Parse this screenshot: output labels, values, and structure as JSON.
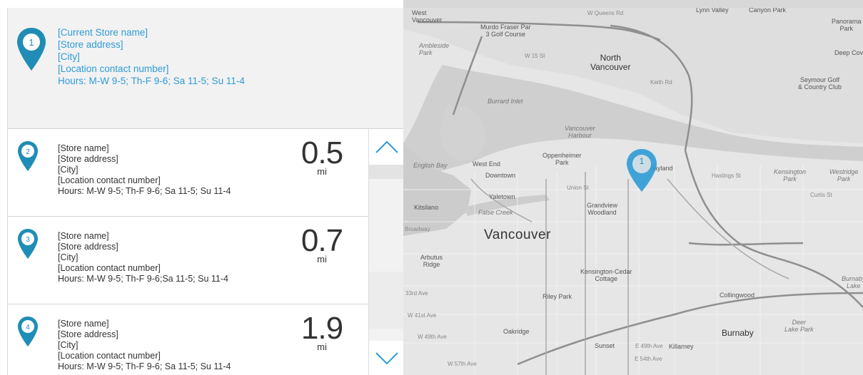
{
  "current_store": {
    "number": "1",
    "name": "[Current Store name]",
    "address": "[Store address]",
    "city": "[City]",
    "contact": "[Location contact number]",
    "hours": "Hours: M-W 9-5; Th-F 9-6; Sa 11-5; Su 11-4"
  },
  "stores": [
    {
      "number": "2",
      "name": "[Store name]",
      "address": "[Store address]",
      "city": "[City]",
      "contact": "[Location contact number]",
      "hours": "Hours: M-W 9-5; Th-F 9-6; Sa 11-5; Su 11-4",
      "distance": "0.5",
      "unit": "mi"
    },
    {
      "number": "3",
      "name": "[Store name]",
      "address": "[Store address]",
      "city": "[City]",
      "contact": "[Location contact number]",
      "hours": "Hours: M-W 9-5; Th-F 9-6;Sa 11-5; Su 11-4",
      "distance": "0.7",
      "unit": "mi"
    },
    {
      "number": "4",
      "name": "[Store name]",
      "address": "[Store address]",
      "city": "[City]",
      "contact": "[Location contact number]",
      "hours": "Hours: M-W 9-5; Th-F 9-6; Sa 11-5; Su 11-4",
      "distance": "1.9",
      "unit": "mi"
    }
  ],
  "map": {
    "pin_number": "1",
    "labels": {
      "west_vancouver": "West\nVancouver",
      "mudro": "Murdo Fraser Par\n3 Golf Course",
      "ambleside": "Ambleside\nPark",
      "w15": "W 15 St",
      "north_vancouver": "North\nVancouver",
      "keith": "Keith Rd",
      "seymour": "Seymour Golf\n& Country Club",
      "burrard_inlet": "Burrard Inlet",
      "vancouver_harbour": "Vancouver\nHarbour",
      "english_bay": "English Bay",
      "west_end": "West End",
      "oppenheimer": "Oppenheimer\nPark",
      "downtown": "Downtown",
      "playland": "Playland",
      "hastings": "Hastings St",
      "kensington": "Kensington\nPark",
      "westridge": "Westridge\nPark",
      "yaletown": "Yaletown",
      "union": "Union St",
      "grandview": "Grandview\nWoodland",
      "kitsilano": "Kitsilano",
      "false_creek": "False Creek",
      "broadway": "Broadway",
      "vancouver": "Vancouver",
      "arbutus": "Arbutus\nRidge",
      "kensington_cedar": "Kensington-Cedar\nCottage",
      "riley": "Riley Park",
      "collingwood": "Collingwood",
      "w33": "33rd Ave",
      "w41": "W 41st Ave",
      "w49": "W 49th Ave",
      "oakridge": "Oakridge",
      "sunset": "Sunset",
      "e49": "E 49th Ave",
      "killarney": "Killarney",
      "e54": "E 54th Ave",
      "burnaby": "Burnaby",
      "deer_lake": "Deer\nLake Park",
      "panorama": "Panorama\nPark",
      "deep_cove": "Deep Cove",
      "canyon": "Canyon Park",
      "lynn": "Lynn Valley",
      "wqueens": "W Queens Rd",
      "burnaby_lake": "Burnaby\nLake",
      "curtis": "Curtis St",
      "w57": "W 57th Ave"
    }
  },
  "colors": {
    "accent": "#2e9bd6",
    "pin": "#1f8db5"
  },
  "icons": {
    "pin": "map-pin-icon",
    "up": "chevron-up-icon",
    "down": "chevron-down-icon"
  }
}
